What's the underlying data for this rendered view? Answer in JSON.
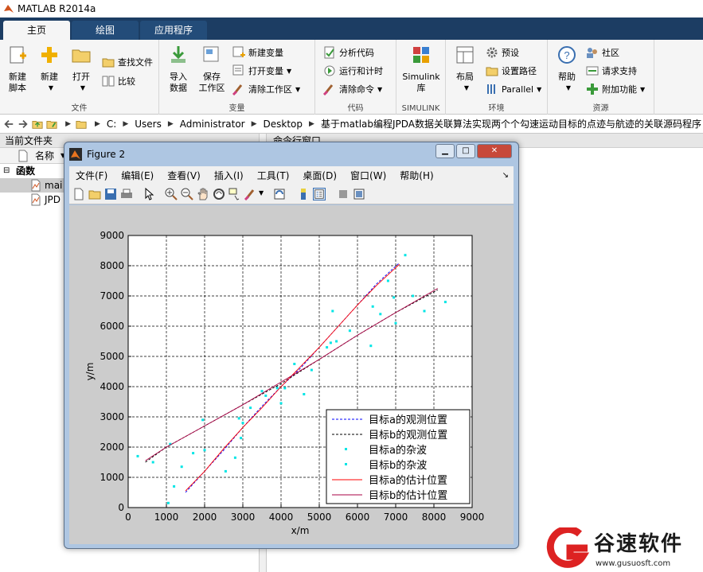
{
  "window": {
    "title": "MATLAB R2014a"
  },
  "tabs": [
    {
      "label": "主页",
      "active": true
    },
    {
      "label": "绘图",
      "active": false
    },
    {
      "label": "应用程序",
      "active": false
    }
  ],
  "ribbon": {
    "file": {
      "label": "文件",
      "new_script": "新建\n脚本",
      "new": "新建",
      "open": "打开",
      "find_files": "查找文件",
      "compare": "比较"
    },
    "variable": {
      "label": "变量",
      "import": "导入\n数据",
      "save_ws": "保存\n工作区",
      "new_var": "新建变量",
      "open_var": "打开变量",
      "clear_ws": "清除工作区"
    },
    "code": {
      "label": "代码",
      "analyze": "分析代码",
      "run_time": "运行和计时",
      "clear_cmd": "清除命令"
    },
    "simulink": {
      "label": "SIMULINK",
      "simulink_lib": "Simulink\n库"
    },
    "env": {
      "label": "环境",
      "layout": "布局",
      "prefs": "预设",
      "set_path": "设置路径",
      "parallel": "Parallel"
    },
    "resources": {
      "label": "资源",
      "help": "帮助",
      "community": "社区",
      "request_support": "请求支持",
      "addons": "附加功能"
    }
  },
  "address": {
    "crumbs": [
      "C:",
      "Users",
      "Administrator",
      "Desktop",
      "基于matlab编程JPDA数据关联算法实现两个个勾速运动目标的点迹与航迹的关联源码程序"
    ]
  },
  "left_panel": {
    "title": "当前文件夹",
    "column_header": "名称",
    "group": "函数",
    "files": [
      "mai",
      "JPD"
    ]
  },
  "command_panel": {
    "title": "命令行窗口"
  },
  "figure": {
    "title": "Figure 2",
    "menu": [
      "文件(F)",
      "编辑(E)",
      "查看(V)",
      "插入(I)",
      "工具(T)",
      "桌面(D)",
      "窗口(W)",
      "帮助(H)"
    ]
  },
  "chart_data": {
    "type": "scatter",
    "xlabel": "x/m",
    "ylabel": "y/m",
    "xlim": [
      0,
      9000
    ],
    "ylim": [
      0,
      9000
    ],
    "xticks": [
      0,
      1000,
      2000,
      3000,
      4000,
      5000,
      6000,
      7000,
      8000,
      9000
    ],
    "yticks": [
      0,
      1000,
      2000,
      3000,
      4000,
      5000,
      6000,
      7000,
      8000,
      9000
    ],
    "grid": true,
    "legend_position": "bottom-right",
    "series": [
      {
        "name": "目标a的观测位置",
        "style": "dashed-line",
        "color": "#0000ff",
        "x": [
          1500,
          2000,
          2500,
          3000,
          3500,
          4000,
          4500,
          5000,
          5500,
          6000,
          6500,
          7100
        ],
        "y": [
          500,
          1200,
          1900,
          2650,
          3350,
          4000,
          4600,
          5300,
          6000,
          6700,
          7400,
          8100
        ]
      },
      {
        "name": "目标b的观测位置",
        "style": "dashed-line",
        "color": "#000000",
        "x": [
          450,
          1000,
          2000,
          3000,
          4000,
          5000,
          6000,
          7000,
          8100
        ],
        "y": [
          1500,
          2000,
          2700,
          3400,
          4100,
          4900,
          5700,
          6450,
          7200
        ]
      },
      {
        "name": "目标a的杂波",
        "style": "points",
        "color": "#00e5e5",
        "x": [
          1050,
          1200,
          1700,
          2000,
          2550,
          2950,
          3000,
          3200,
          3600,
          3900,
          4000,
          4350,
          4800,
          5200,
          5300,
          5450,
          5800,
          6400,
          6600,
          6800,
          7000,
          7250
        ],
        "y": [
          150,
          700,
          1800,
          1900,
          1200,
          2300,
          2800,
          3300,
          3700,
          3950,
          3450,
          4750,
          4550,
          5300,
          5450,
          5500,
          5850,
          6650,
          6400,
          7500,
          6100,
          8350
        ]
      },
      {
        "name": "目标b的杂波",
        "style": "points",
        "color": "#00e5e5",
        "x": [
          250,
          650,
          1100,
          1400,
          1950,
          2800,
          2900,
          3500,
          4100,
          4600,
          5350,
          6350,
          6950,
          7450,
          7750,
          8300
        ],
        "y": [
          1700,
          1500,
          2100,
          1350,
          2900,
          1650,
          2950,
          3850,
          3950,
          3750,
          6500,
          5350,
          6950,
          7000,
          6500,
          6800
        ]
      },
      {
        "name": "目标a的估计位置",
        "style": "solid-line",
        "color": "#ff0000",
        "x": [
          1500,
          2000,
          2500,
          3000,
          3500,
          4000,
          4500,
          5000,
          5500,
          6000,
          6500,
          7100
        ],
        "y": [
          550,
          1200,
          1950,
          2650,
          3300,
          4000,
          4650,
          5300,
          6000,
          6700,
          7350,
          8050
        ]
      },
      {
        "name": "目标b的估计位置",
        "style": "solid-line",
        "color": "#aa0044",
        "x": [
          450,
          1000,
          2000,
          3000,
          4000,
          5000,
          6000,
          7000,
          8100
        ],
        "y": [
          1550,
          2000,
          2700,
          3400,
          4150,
          4900,
          5700,
          6450,
          7250
        ]
      }
    ]
  },
  "watermark": {
    "name": "谷速软件",
    "url": "www.gusuosft.com"
  }
}
